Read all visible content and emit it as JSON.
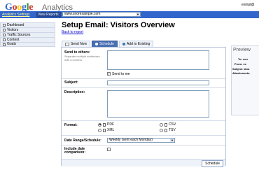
{
  "header": {
    "logo_text": "Google",
    "product": "Analytics",
    "user_email": "exmpl@"
  },
  "topbar": {
    "settings_link": "Analytics Settings",
    "view_reports_label": "View Reports:",
    "site": "www.shorexample.com"
  },
  "sidebar": {
    "items": [
      {
        "label": "Dashboard",
        "icon": "dashboard-icon"
      },
      {
        "label": "Visitors",
        "icon": "visitors-icon"
      },
      {
        "label": "Traffic Sources",
        "icon": "traffic-sources-icon"
      },
      {
        "label": "Content",
        "icon": "content-icon"
      },
      {
        "label": "Goals",
        "icon": "goals-icon"
      }
    ]
  },
  "main": {
    "title": "Setup Email: Visitors Overview",
    "back_link": "Back to report",
    "tabs": [
      {
        "label": "Send Now"
      },
      {
        "label": "Schedule"
      },
      {
        "label": "Add to Existing"
      }
    ]
  },
  "form": {
    "send_to_label": "Send to others:",
    "send_to_hint": "Separate multiple addresses with a comma.",
    "send_to_me": "Send to me",
    "subject_label": "Subject:",
    "description_label": "Description:",
    "format_label": "Format:",
    "formats": [
      "PDF",
      "CSV",
      "XML",
      "TSV"
    ],
    "date_range_label": "Date Range/Schedule:",
    "date_range_value": "Weekly (sent each Monday)",
    "include_label": "Include date comparison:",
    "schedule_button": "Schedule"
  },
  "preview": {
    "title": "Preview",
    "to_label": "To: sen",
    "from_label": "From: ex",
    "subject_label": "Subject: Ana",
    "attachments_label": "Attachments:"
  },
  "colors": {
    "topbar": "#3366cc",
    "link": "#0000cc",
    "active_tab": "#4a6fb3"
  }
}
